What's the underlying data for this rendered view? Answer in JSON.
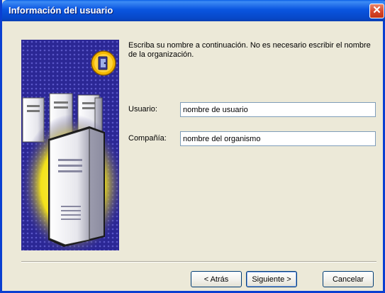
{
  "window": {
    "title": "Información del usuario",
    "close_glyph": "✕"
  },
  "instruction": "Escriba su nombre a continuación. No es necesario escribir el nombre de la organización.",
  "fields": {
    "user": {
      "label": "Usuario:",
      "value": "nombre de usuario"
    },
    "company": {
      "label": "Compañía:",
      "value": "nombre del organismo"
    }
  },
  "buttons": {
    "back": "< Atrás",
    "next": "Siguiente >",
    "cancel": "Cancelar"
  },
  "icons": {
    "art": "server-computers-illustration",
    "badge": "key-badge-icon",
    "close": "close-icon"
  },
  "colors": {
    "titlebar": "#0a55e0",
    "art_background": "#2b2795",
    "highlight": "#f7e51e"
  }
}
